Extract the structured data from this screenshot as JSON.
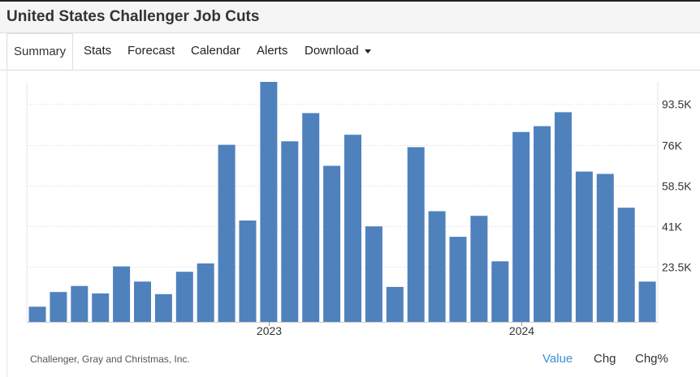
{
  "header": {
    "title": "United States Challenger Job Cuts"
  },
  "tabs": [
    {
      "label": "Summary",
      "active": true
    },
    {
      "label": "Stats"
    },
    {
      "label": "Forecast"
    },
    {
      "label": "Calendar"
    },
    {
      "label": "Alerts"
    },
    {
      "label": "Download",
      "has_dropdown": true
    }
  ],
  "footer": {
    "source": "Challenger, Gray and Christmas, Inc.",
    "modes": [
      {
        "label": "Value",
        "active": true,
        "color": "#3b8fd9"
      },
      {
        "label": "Chg",
        "color": "#333333"
      },
      {
        "label": "Chg%",
        "color": "#333333"
      }
    ]
  },
  "chart_data": {
    "type": "bar",
    "bar_color": "#4f81bd",
    "grid": true,
    "y_axis_side": "right",
    "ylim": [
      0,
      103000
    ],
    "y_ticks": [
      {
        "value": 23500,
        "label": "23.5K"
      },
      {
        "value": 41000,
        "label": "41K"
      },
      {
        "value": 58500,
        "label": "58.5K"
      },
      {
        "value": 76000,
        "label": "76K"
      },
      {
        "value": 93500,
        "label": "93.5K"
      }
    ],
    "x_ticks": [
      {
        "index": 11.5,
        "label": "2023"
      },
      {
        "index": 23.5,
        "label": "2024"
      }
    ],
    "values": [
      6500,
      12800,
      15400,
      12200,
      23800,
      17300,
      11900,
      21500,
      25100,
      76000,
      43500,
      103000,
      77500,
      89600,
      67000,
      80300,
      41000,
      15000,
      75000,
      47500,
      36500,
      45500,
      26000,
      81500,
      84000,
      90000,
      64500,
      63500,
      49000,
      17300
    ]
  }
}
